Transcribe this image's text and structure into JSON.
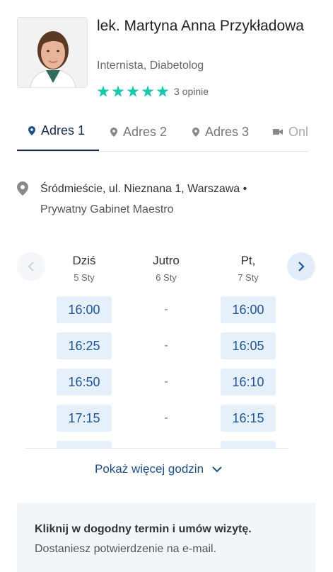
{
  "doctor": {
    "name": "lek. Martyna Anna Przykładowa",
    "specialty": "Internista, Diabetolog",
    "rating_stars": 5,
    "reviews_label": "3 opinie",
    "star_color": "#16c8ac"
  },
  "tabs": [
    {
      "label": "Adres 1",
      "icon": "map-pin-icon",
      "active": true
    },
    {
      "label": "Adres 2",
      "icon": "map-pin-icon",
      "active": false
    },
    {
      "label": "Adres 3",
      "icon": "map-pin-icon",
      "active": false
    },
    {
      "label": "Onli",
      "icon": "video-camera-icon",
      "active": false
    }
  ],
  "address": {
    "line1": "Śródmieście, ul. Nieznana 1, Warszawa  •",
    "line2": "Prywatny Gabinet Maestro"
  },
  "calendar": {
    "days": [
      {
        "name": "Dziś",
        "date": "5 Sty",
        "slots": [
          "16:00",
          "16:25",
          "16:50",
          "17:15",
          ""
        ]
      },
      {
        "name": "Jutro",
        "date": "6 Sty",
        "slots": [
          "-",
          "-",
          "-",
          "-"
        ]
      },
      {
        "name": "Pt,",
        "date": "7 Sty",
        "slots": [
          "16:00",
          "16:05",
          "16:10",
          "16:15",
          ""
        ]
      }
    ]
  },
  "more_hours_label": "Pokaż więcej godzin",
  "info": {
    "bold": "Kliknij w dogodny termin i umów wizytę.",
    "text": "Dostaniesz potwierdzenie na e-mail."
  },
  "colors": {
    "accent": "#1e5597",
    "slot_bg": "#e6f0fb",
    "tab_active": "#1a2a4a"
  }
}
